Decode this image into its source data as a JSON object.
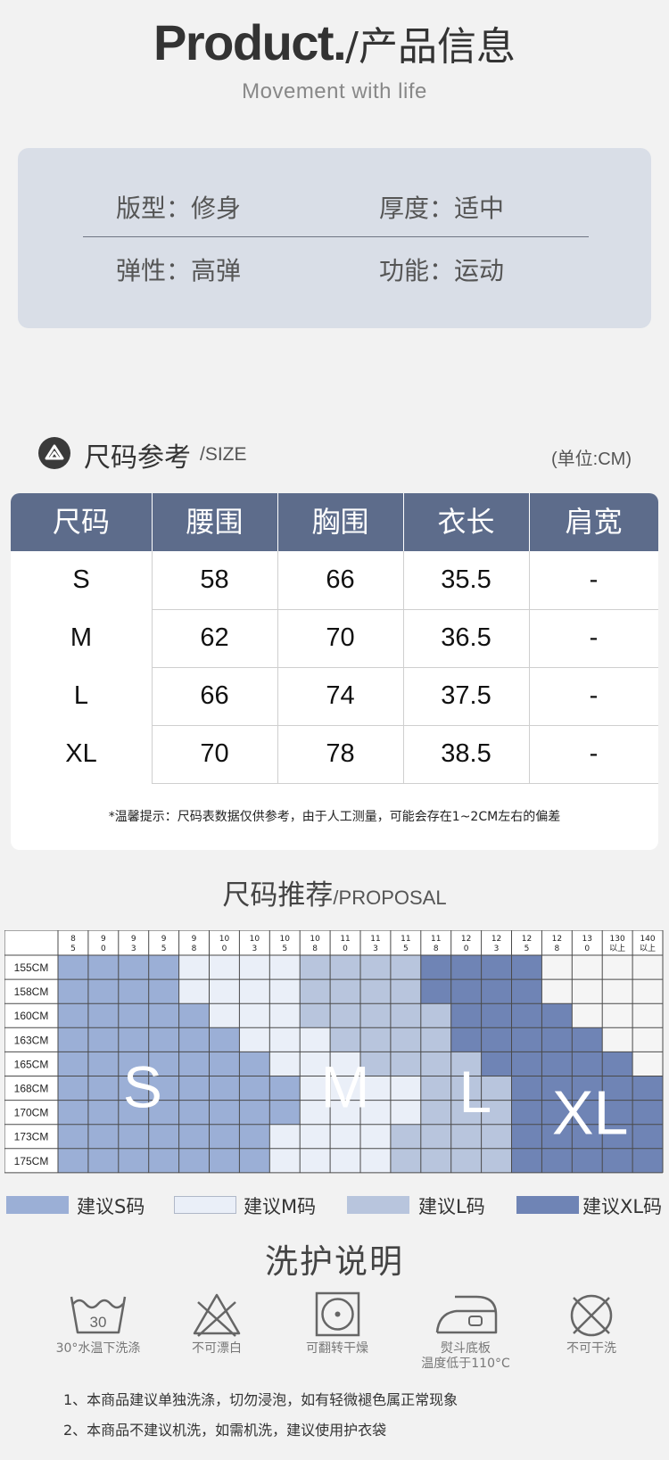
{
  "header": {
    "title_en": "Product.",
    "title_cn": "/产品信息",
    "subtitle": "Movement with life"
  },
  "info": {
    "row1": {
      "left": "版型：修身",
      "right": "厚度：适中"
    },
    "row2": {
      "left": "弹性：高弹",
      "right": "功能：运动"
    }
  },
  "size_section": {
    "title_cn": "尺码参考",
    "title_en": "/SIZE",
    "unit": "(单位:CM)",
    "icon": "brand-logo-icon",
    "columns": [
      "尺码",
      "腰围",
      "胸围",
      "衣长",
      "肩宽"
    ],
    "rows": [
      [
        "S",
        "58",
        "66",
        "35.5",
        "-"
      ],
      [
        "M",
        "62",
        "70",
        "36.5",
        "-"
      ],
      [
        "L",
        "66",
        "74",
        "37.5",
        "-"
      ],
      [
        "XL",
        "70",
        "78",
        "38.5",
        "-"
      ]
    ],
    "note": "*温馨提示：尺码表数据仅供参考，由于人工测量，可能会存在1~2CM左右的偏差"
  },
  "proposal": {
    "title_cn": "尺码推荐",
    "title_en": "/PROPOSAL",
    "weights": [
      "85",
      "90",
      "93",
      "95",
      "98",
      "100",
      "103",
      "105",
      "108",
      "110",
      "113",
      "115",
      "118",
      "120",
      "123",
      "125",
      "128",
      "130",
      "130以上",
      "140以上"
    ],
    "heights": [
      "155CM",
      "158CM",
      "160CM",
      "163CM",
      "165CM",
      "168CM",
      "170CM",
      "173CM",
      "175CM"
    ],
    "grid": [
      "SSSSMMMMLLLLXXXXEEEE",
      "SSSSMMMMLLLLXXXXEEEE",
      "SSSSSMMMLLLLLXXXXEEE",
      "SSSSSSMMMLLLLXXXXXEE",
      "SSSSSSSMMMLLLLXXXXXE",
      "SSSSSSSSMMMMLLLXXXXX",
      "SSSSSSSSMMMMLLLXXXXX",
      "SSSSSSSMMMMLLLLXXXXX",
      "SSSSSSSMMMMLLLLXXXXX"
    ],
    "zone_labels": {
      "S": "S",
      "M": "M",
      "L": "L",
      "XL": "XL"
    },
    "colors": {
      "S": "#9bafd6",
      "M": "#eaeff8",
      "L": "#b8c5dd",
      "XL": "#6f84b5",
      "E": "#f5f5f5"
    },
    "legend": [
      {
        "key": "S",
        "label": "建议S码"
      },
      {
        "key": "M",
        "label": "建议M码"
      },
      {
        "key": "L",
        "label": "建议L码"
      },
      {
        "key": "XL",
        "label": "建议XL码"
      }
    ]
  },
  "care": {
    "title": "洗护说明",
    "items": [
      {
        "icon": "wash-30-icon",
        "temp": "30",
        "label": "30°水温下洗涤"
      },
      {
        "icon": "no-bleach-icon",
        "label": "不可漂白"
      },
      {
        "icon": "tumble-dry-icon",
        "label": "可翻转干燥"
      },
      {
        "icon": "iron-icon",
        "label": "熨斗底板",
        "label2": "温度低于110°C"
      },
      {
        "icon": "no-dry-clean-icon",
        "label": "不可干洗"
      }
    ],
    "notes": [
      "1、本商品建议单独洗涤，切勿浸泡，如有轻微褪色属正常现象",
      "2、本商品不建议机洗，如需机洗，建议使用护衣袋"
    ]
  }
}
